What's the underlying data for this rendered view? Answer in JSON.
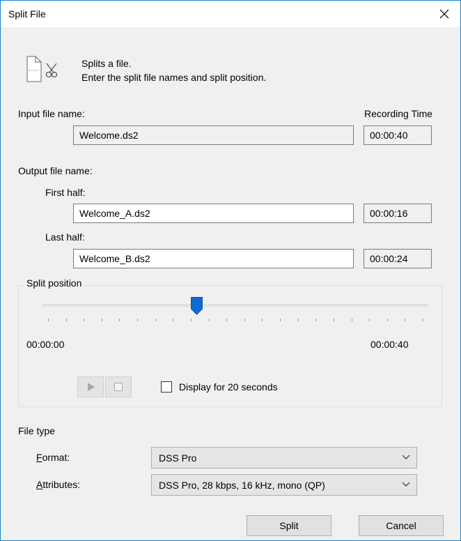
{
  "window": {
    "title": "Split File",
    "close_label": "✕"
  },
  "description": {
    "line1": "Splits a file.",
    "line2": "Enter the split file names and split position."
  },
  "input": {
    "label": "Input file name:",
    "recording_time_label": "Recording Time",
    "file_name": "Welcome.ds2",
    "time": "00:00:40"
  },
  "output": {
    "label": "Output file name:",
    "first_half_label": "First half:",
    "first_half_name": "Welcome_A.ds2",
    "first_half_time": "00:00:16",
    "last_half_label": "Last half:",
    "last_half_name": "Welcome_B.ds2",
    "last_half_time": "00:00:24"
  },
  "split_position": {
    "title": "Split position",
    "start_time": "00:00:00",
    "end_time": "00:00:40",
    "position_fraction": 0.4,
    "display_20s_label": "Display for 20 seconds",
    "display_20s_checked": false
  },
  "file_type": {
    "title": "File type",
    "format_label": "Format:",
    "format_label_mnemonic": "F",
    "format_label_rest": "ormat:",
    "format_value": "DSS Pro",
    "attributes_label": "Attributes:",
    "attributes_label_mnemonic": "A",
    "attributes_label_rest": "ttributes:",
    "attributes_value": "DSS Pro, 28 kbps, 16 kHz, mono (QP)"
  },
  "buttons": {
    "split": "Split",
    "cancel": "Cancel"
  },
  "colors": {
    "window_border": "#1883d7",
    "slider_thumb": "#0f6ad1"
  }
}
